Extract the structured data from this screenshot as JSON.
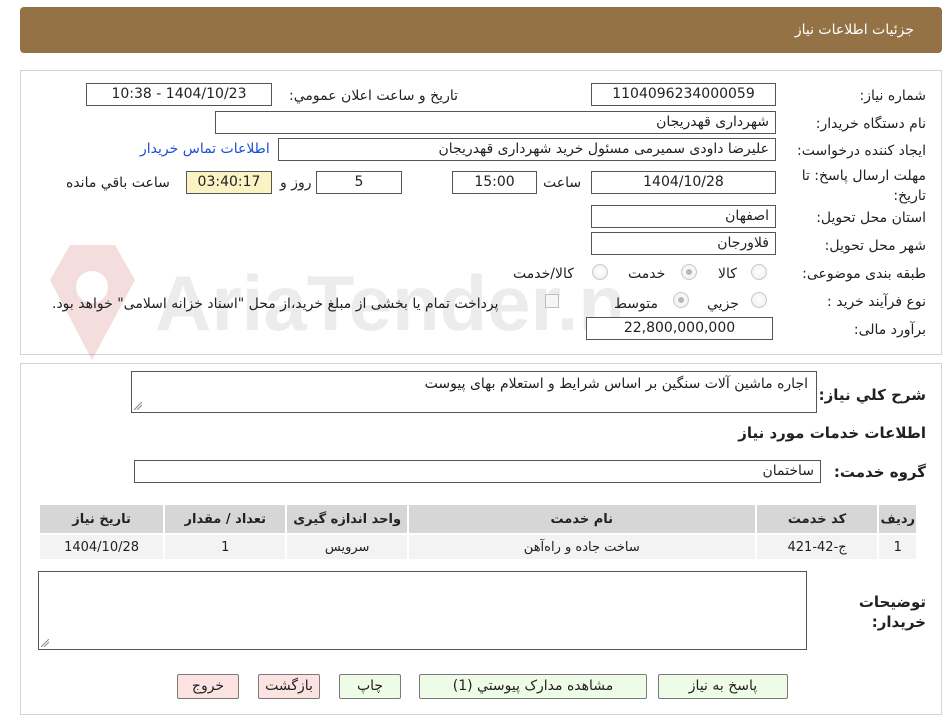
{
  "header": {
    "title": "جزئیات اطلاعات نیاز"
  },
  "fields": {
    "need_number_label": "شماره نیاز:",
    "need_number": "1104096234000059",
    "announce_label": "تاریخ و ساعت اعلان عمومي:",
    "announce_value": "1404/10/23 - 10:38",
    "buyer_org_label": "نام دستگاه خريدار:",
    "buyer_org": "شهرداری قهدریجان",
    "creator_label": "ایجاد کننده درخواست:",
    "creator": "علیرضا داودی سمیرمی مسئول خرید  شهرداری قهدریجان",
    "contact_link": "اطلاعات تماس خریدار",
    "deadline_label": "مهلت ارسال پاسخ: تا تاریخ:",
    "deadline_date": "1404/10/28",
    "time_label": "ساعت",
    "deadline_time": "15:00",
    "days": "5",
    "days_label": "روز و",
    "remaining": "03:40:17",
    "remaining_label": "ساعت باقي مانده",
    "province_label": "استان محل تحویل:",
    "province": "اصفهان",
    "city_label": "شهر محل تحویل:",
    "city": "فلاورجان",
    "category_label": "طبقه بندی موضوعی:",
    "category_options": [
      "کالا",
      "خدمت",
      "کالا/خدمت"
    ],
    "category_selected": "خدمت",
    "process_label": "نوع فرآیند خرید :",
    "process_options": [
      "جزیي",
      "متوسط"
    ],
    "process_selected": "متوسط",
    "payment_note": "پرداخت تمام یا بخشی از مبلغ خرید،از محل \"اسناد خزانه اسلامی\" خواهد بود.",
    "budget_label": "برآورد مالی:",
    "budget": "22,800,000,000"
  },
  "description": {
    "label": "شرح کلي نياز:",
    "text": "اجاره ماشین آلات سنگین بر اساس شرایط و استعلام بهای پیوست"
  },
  "services": {
    "section_title": "اطلاعات خدمات مورد نياز",
    "group_label": "گروه خدمت:",
    "group_value": "ساختمان",
    "columns": [
      "رديف",
      "کد خدمت",
      "نام خدمت",
      "واحد اندازه گيری",
      "تعداد / مقدار",
      "تاريخ نياز"
    ],
    "rows": [
      [
        "1",
        "ج-42-421",
        "ساخت جاده و راه‌آهن",
        "سرویس",
        "1",
        "1404/10/28"
      ]
    ]
  },
  "buyer_notes": {
    "label": "توضيحات خريدار:",
    "text": ""
  },
  "buttons": {
    "reply": "پاسخ به نياز",
    "attachments": "مشاهده مدارک پيوستي (1)",
    "print": "چاپ",
    "back": "بازگشت",
    "exit": "خروج"
  },
  "watermark": {
    "text": "AriaTender.neT"
  },
  "colors": {
    "header_bg": "#957245",
    "link": "#1a4fd6",
    "timer_bg": "#fbf3c4",
    "button_green": "#eefbe6",
    "button_pink": "#fde2e2"
  }
}
